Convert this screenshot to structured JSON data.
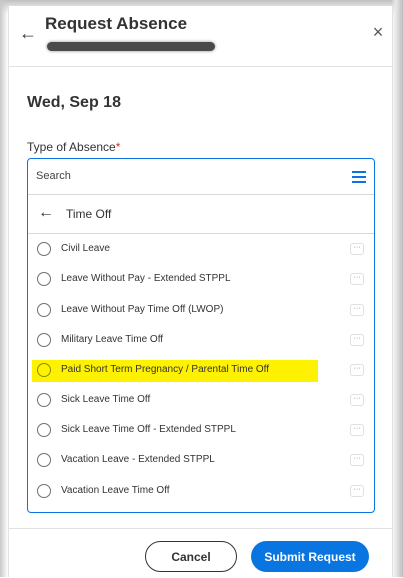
{
  "header": {
    "title": "Request Absence",
    "back_icon": "←",
    "close_icon": "×"
  },
  "date": "Wed, Sep 18",
  "field": {
    "label": "Type of Absence",
    "required_marker": "*"
  },
  "search": {
    "placeholder": "Search",
    "value": ""
  },
  "category": {
    "back_icon": "←",
    "label": "Time Off"
  },
  "options": [
    {
      "label": "Civil Leave",
      "highlighted": false
    },
    {
      "label": "Leave Without Pay - Extended STPPL",
      "highlighted": false
    },
    {
      "label": "Leave Without Pay Time Off (LWOP)",
      "highlighted": false
    },
    {
      "label": "Military Leave Time Off",
      "highlighted": false
    },
    {
      "label": "Paid Short Term Pregnancy / Parental Time Off",
      "highlighted": true
    },
    {
      "label": "Sick Leave Time Off",
      "highlighted": false
    },
    {
      "label": "Sick Leave Time Off - Extended STPPL",
      "highlighted": false
    },
    {
      "label": "Vacation Leave - Extended STPPL",
      "highlighted": false
    },
    {
      "label": "Vacation Leave Time Off",
      "highlighted": false
    }
  ],
  "more_icon": "···",
  "footer": {
    "cancel_label": "Cancel",
    "submit_label": "Submit Request"
  },
  "colors": {
    "accent": "#0875e1",
    "required": "#de2e21",
    "highlight": "#fff200"
  }
}
